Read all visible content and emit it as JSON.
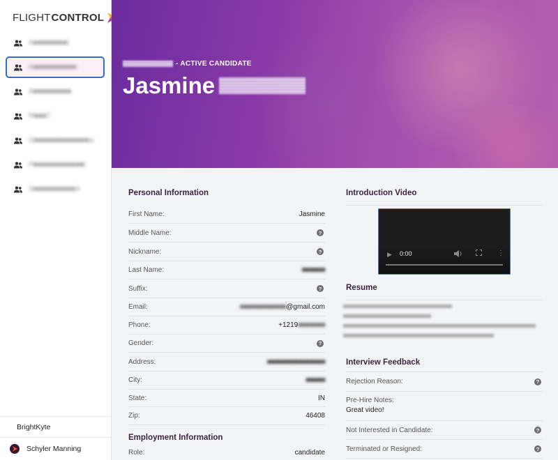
{
  "app": {
    "logo_part1": "FLIGHT",
    "logo_part2": "CONTROL"
  },
  "sidebar": {
    "items": [
      {
        "label": "A■■■■■■■■t",
        "icon": "people-icon",
        "active": false
      },
      {
        "label": "A■■■■■■■■■■t",
        "icon": "people-icon",
        "active": true
      },
      {
        "label": "A■■■■■■■■■",
        "icon": "people-icon",
        "active": false
      },
      {
        "label": "R■■■T",
        "icon": "people-icon",
        "active": false
      },
      {
        "label": "O■■■■■■■■■■■■■w",
        "icon": "people-icon",
        "active": false
      },
      {
        "label": "P■■■■■■■■■■■■t",
        "icon": "people-icon",
        "active": false
      },
      {
        "label": "S■■■■■■■■■■A",
        "icon": "people-icon",
        "active": false
      }
    ],
    "company": "BrightKyte",
    "user": "Schyler Manning"
  },
  "hero": {
    "subtitle": "- ACTIVE CANDIDATE",
    "first_name": "Jasmine"
  },
  "personal": {
    "title": "Personal Information",
    "first_name_label": "First Name:",
    "first_name": "Jasmine",
    "middle_name_label": "Middle Name:",
    "nickname_label": "Nickname:",
    "last_name_label": "Last Name:",
    "last_name": "■■■■■■",
    "suffix_label": "Suffix:",
    "email_label": "Email:",
    "email_redacted": "■■■■■■■■■■■■",
    "email_domain": "@gmail.com",
    "phone_label": "Phone:",
    "phone_prefix": "+1219",
    "phone_redacted": "■■■■■■■",
    "gender_label": "Gender:",
    "address_label": "Address:",
    "address": "■■■■■■■■■■■■■■■",
    "city_label": "City:",
    "city": "■■■■■",
    "state_label": "State:",
    "state": "IN",
    "zip_label": "Zip:",
    "zip": "46408"
  },
  "employment": {
    "title": "Employment Information",
    "role_label": "Role:",
    "role": "candidate"
  },
  "video": {
    "title": "Introduction Video",
    "time": "0:00"
  },
  "resume": {
    "title": "Resume"
  },
  "feedback": {
    "title": "Interview Feedback",
    "rejection_label": "Rejection Reason:",
    "prehire_label": "Pre-Hire Notes:",
    "prehire_value": "Great video!",
    "not_interested_label": "Not Interested in Candidate:",
    "terminated_label": "Terminated or Resigned:"
  },
  "colors": {
    "accent_purple": "#7a2f9f",
    "active_border": "#2c6fce",
    "section_title": "#3b2640"
  }
}
